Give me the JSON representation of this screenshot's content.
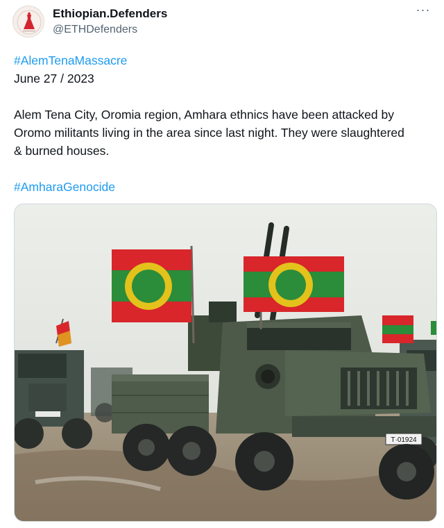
{
  "tweet": {
    "author": {
      "display_name": "Ethiopian.Defenders",
      "handle": "@ETHDefenders",
      "avatar_icon": "red-dress-logo"
    },
    "more_menu_icon": "more-horizontal-icon",
    "hashtag_top": "#AlemTenaMassacre",
    "date_line": "June 27 / 2023",
    "paragraph_lines": [
      "Alem Tena City, Oromia region, Amhara ethnics have been attacked by",
      "Oromo militants living in the area since last night. They were slaughtered",
      "& burned houses."
    ],
    "hashtag_bottom": "#AmharaGenocide",
    "media": {
      "kind": "photo",
      "plate_text": "T·01924"
    }
  },
  "colors": {
    "link": "#1d9bf0",
    "text": "#0f1419",
    "secondary": "#536471",
    "flag_red": "#d8262b",
    "flag_green": "#2b8c3a",
    "flag_yellow": "#e3c21c",
    "truck_green": "#4d5a49"
  }
}
